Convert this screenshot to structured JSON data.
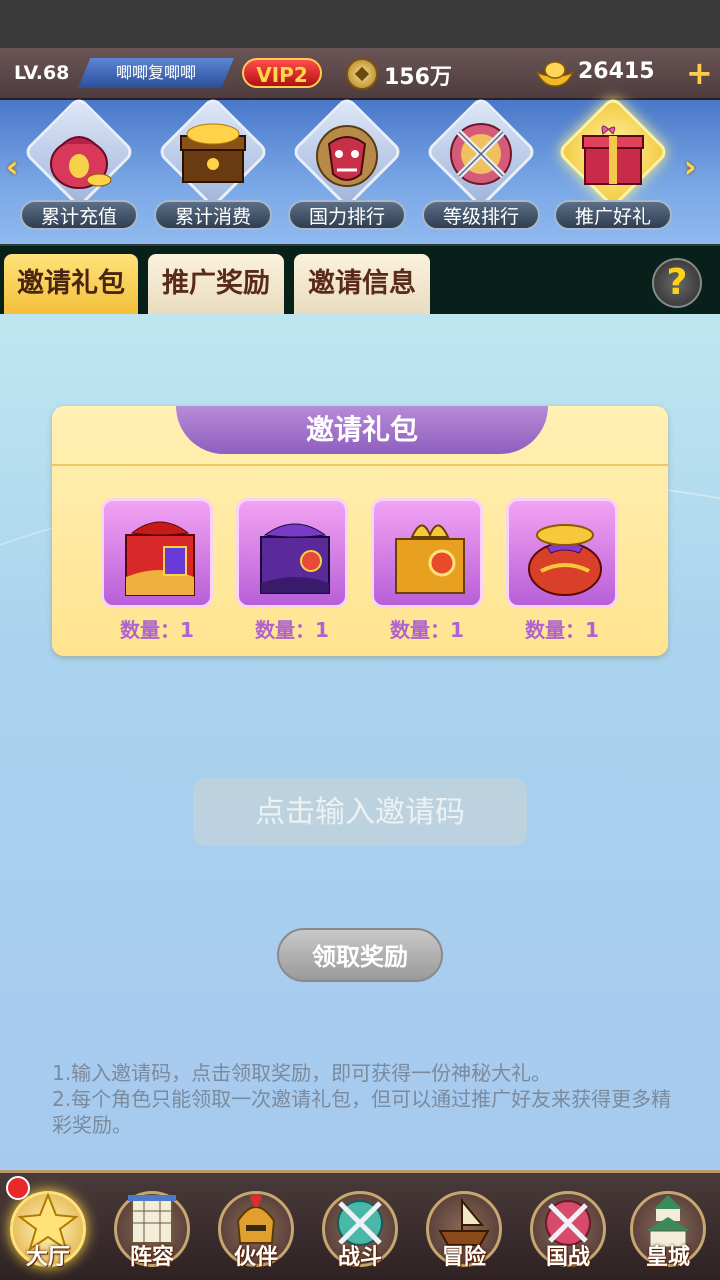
{
  "player": {
    "level": "LV.68",
    "name": "唧唧复唧唧",
    "vip": "VIP2",
    "coins": "156万",
    "gold": "26415",
    "plus": "+"
  },
  "events": [
    {
      "label": "累计充值",
      "icon": "money-bag-icon"
    },
    {
      "label": "累计消费",
      "icon": "treasure-chest-icon"
    },
    {
      "label": "国力排行",
      "icon": "demon-mask-icon"
    },
    {
      "label": "等级排行",
      "icon": "crossed-swords-icon"
    },
    {
      "label": "推广好礼",
      "icon": "gift-chest-icon"
    }
  ],
  "tabs": [
    "邀请礼包",
    "推广奖励",
    "邀请信息"
  ],
  "help": "?",
  "gift_pack": {
    "title": "邀请礼包",
    "items": [
      {
        "qty": "数量：1",
        "icon": "red-gift-box-icon"
      },
      {
        "qty": "数量：1",
        "icon": "purple-gift-box-icon"
      },
      {
        "qty": "数量：1",
        "icon": "gold-gift-box-icon"
      },
      {
        "qty": "数量：1",
        "icon": "coin-bag-icon"
      }
    ]
  },
  "invite": {
    "placeholder": "点击输入邀请码",
    "claim_label": "领取奖励"
  },
  "notes": [
    "1.输入邀请码，点击领取奖励，即可获得一份神秘大礼。",
    "2.每个角色只能领取一次邀请礼包，但可以通过推广好友来获得更多精彩奖励。"
  ],
  "bottom_nav": [
    {
      "label": "大厅",
      "icon": "hall-icon"
    },
    {
      "label": "阵容",
      "icon": "lineup-icon"
    },
    {
      "label": "伙伴",
      "icon": "partner-helmet-icon"
    },
    {
      "label": "战斗",
      "icon": "battle-swords-icon"
    },
    {
      "label": "冒险",
      "icon": "ship-icon"
    },
    {
      "label": "国战",
      "icon": "nation-war-icon"
    },
    {
      "label": "皇城",
      "icon": "castle-icon"
    }
  ]
}
